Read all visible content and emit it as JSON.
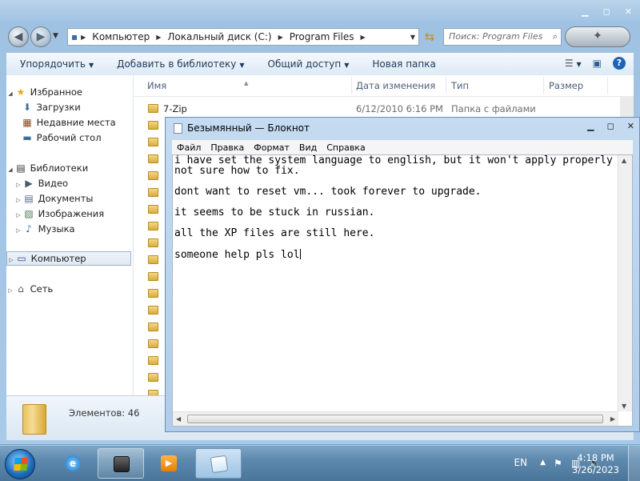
{
  "explorer": {
    "address": [
      "Компьютер",
      "Локальный диск (C:)",
      "Program Files"
    ],
    "search_placeholder": "Поиск: Program Files",
    "toolbar": {
      "organize": "Упорядочить",
      "add_to_library": "Добавить в библиотеку",
      "share": "Общий доступ",
      "new_folder": "Новая папка"
    },
    "nav": {
      "favorites": "Избранное",
      "downloads": "Загрузки",
      "recent": "Недавние места",
      "desktop": "Рабочий стол",
      "libraries": "Библиотеки",
      "video": "Видео",
      "documents": "Документы",
      "images": "Изображения",
      "music": "Музыка",
      "computer": "Компьютер",
      "network": "Сеть"
    },
    "columns": {
      "name": "Имя",
      "date": "Дата изменения",
      "type": "Тип",
      "size": "Размер"
    },
    "files": [
      {
        "name": "7-Zip",
        "date": "6/12/2010 6:16 PM",
        "type": "Папка с файлами"
      }
    ],
    "item_count": "Элементов: 46"
  },
  "notepad": {
    "title": "Безымянный — Блокнот",
    "menu": [
      "Файл",
      "Правка",
      "Формат",
      "Вид",
      "Справка"
    ],
    "lines": [
      "i have set the system language to english, but it won't apply properly",
      "not sure how to fix.",
      "",
      "dont want to reset vm... took forever to upgrade.",
      "",
      "it seems to be stuck in russian.",
      "",
      "all the XP files are still here.",
      "",
      "someone help pls lol"
    ]
  },
  "taskbar": {
    "language": "EN",
    "time": "4:18 PM",
    "date": "3/26/2023"
  }
}
